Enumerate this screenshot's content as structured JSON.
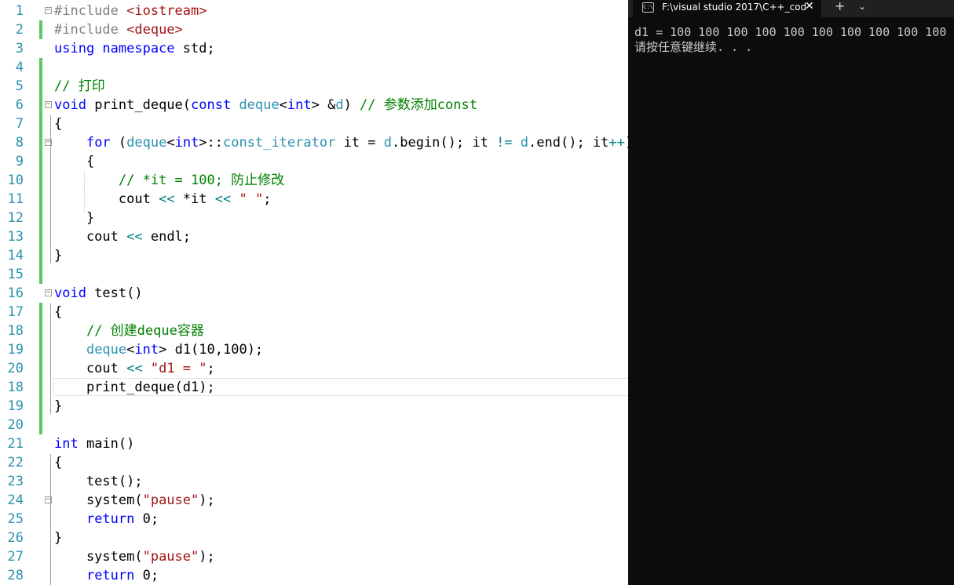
{
  "editor": {
    "line_numbers": [
      "1",
      "2",
      "3",
      "4",
      "5",
      "6",
      "7",
      "8",
      "9",
      "10",
      "11",
      "12",
      "13",
      "14",
      "15",
      "16",
      "17",
      "18",
      "19",
      "20",
      "18",
      "19",
      "20",
      "21",
      "22",
      "23",
      "24",
      "25",
      "26",
      "27",
      "28"
    ],
    "lines": [
      [
        [
          "#include ",
          "pp"
        ],
        [
          "<iostream>",
          "str"
        ]
      ],
      [
        [
          "#include ",
          "pp"
        ],
        [
          "<deque>",
          "str"
        ]
      ],
      [
        [
          "using namespace ",
          "kw"
        ],
        [
          "std;",
          ""
        ]
      ],
      [],
      [
        [
          "// 打印",
          "cm"
        ]
      ],
      [
        [
          "void ",
          "kw"
        ],
        [
          "print_deque(",
          ""
        ],
        [
          "const ",
          "kw"
        ],
        [
          "deque",
          "ty"
        ],
        [
          "<",
          ""
        ],
        [
          "int",
          "kw"
        ],
        [
          "> &",
          ""
        ],
        [
          "d",
          "ty"
        ],
        [
          ") ",
          ""
        ],
        [
          "// 参数添加const",
          "cm"
        ]
      ],
      [
        [
          "{",
          ""
        ]
      ],
      [
        [
          "    ",
          ""
        ],
        [
          "for ",
          "kw"
        ],
        [
          "(",
          ""
        ],
        [
          "deque",
          "ty"
        ],
        [
          "<",
          ""
        ],
        [
          "int",
          "kw"
        ],
        [
          ">::",
          ""
        ],
        [
          "const_iterator",
          "ty"
        ],
        [
          " it = ",
          ""
        ],
        [
          "d",
          "ty"
        ],
        [
          ".begin(); it ",
          ""
        ],
        [
          "!=",
          "op"
        ],
        [
          " ",
          ""
        ],
        [
          "d",
          "ty"
        ],
        [
          ".end(); it",
          ""
        ],
        [
          "++",
          "op"
        ],
        [
          ")",
          ""
        ]
      ],
      [
        [
          "    {",
          ""
        ]
      ],
      [
        [
          "        ",
          ""
        ],
        [
          "// *it = 100; 防止修改",
          "cm"
        ]
      ],
      [
        [
          "        cout ",
          ""
        ],
        [
          "<<",
          "op"
        ],
        [
          " *it ",
          ""
        ],
        [
          "<<",
          "op"
        ],
        [
          " ",
          ""
        ],
        [
          "\" \"",
          "str"
        ],
        [
          ";",
          ""
        ]
      ],
      [
        [
          "    }",
          ""
        ]
      ],
      [
        [
          "    cout ",
          ""
        ],
        [
          "<<",
          "op"
        ],
        [
          " endl;",
          ""
        ]
      ],
      [
        [
          "}",
          ""
        ]
      ],
      [],
      [
        [
          "void ",
          "kw"
        ],
        [
          "test()",
          ""
        ]
      ],
      [
        [
          "{",
          ""
        ]
      ],
      [
        [
          "    ",
          ""
        ],
        [
          "// 创建deque容器",
          "cm"
        ]
      ],
      [
        [
          "    ",
          ""
        ],
        [
          "deque",
          "ty"
        ],
        [
          "<",
          ""
        ],
        [
          "int",
          "kw"
        ],
        [
          "> d1(10,100);",
          ""
        ]
      ],
      [
        [
          "    cout ",
          ""
        ],
        [
          "<<",
          "op"
        ],
        [
          " ",
          ""
        ],
        [
          "\"d1 = \"",
          "str"
        ],
        [
          ";",
          ""
        ]
      ],
      [
        [
          "    print_deque(d1);",
          ""
        ]
      ],
      [
        [
          "}",
          ""
        ]
      ],
      [],
      [
        [
          "int ",
          "kw"
        ],
        [
          "main()",
          ""
        ]
      ],
      [
        [
          "{",
          ""
        ]
      ],
      [
        [
          "    test();",
          ""
        ]
      ],
      [
        [
          "    system(",
          ""
        ],
        [
          "\"pause\"",
          "str"
        ],
        [
          ");",
          ""
        ]
      ],
      [
        [
          "    ",
          ""
        ],
        [
          "return ",
          "kw"
        ],
        [
          "0;",
          ""
        ]
      ],
      [
        [
          "}",
          ""
        ]
      ],
      [
        [
          "    system(",
          ""
        ],
        [
          "\"pause\"",
          "str"
        ],
        [
          ");",
          ""
        ]
      ],
      [
        [
          "    ",
          ""
        ],
        [
          "return ",
          "kw"
        ],
        [
          "0;",
          ""
        ]
      ]
    ]
  },
  "terminal": {
    "tab_title": "F:\\visual studio 2017\\C++_cod",
    "tab_icon_text": "C:\\",
    "close_glyph": "✕",
    "add_glyph": "+",
    "dropdown_glyph": "⌄",
    "output": [
      "d1 = 100 100 100 100 100 100 100 100 100 100",
      "请按任意键继续. . ."
    ]
  },
  "colors": {
    "keyword": "#0000ff",
    "type": "#2b91af",
    "string": "#a31515",
    "comment": "#008000",
    "preprocessor": "#808080",
    "operator": "#008080",
    "change_marker": "#5ec75e",
    "terminal_bg": "#0c0c0c",
    "terminal_text": "#cccccc"
  }
}
